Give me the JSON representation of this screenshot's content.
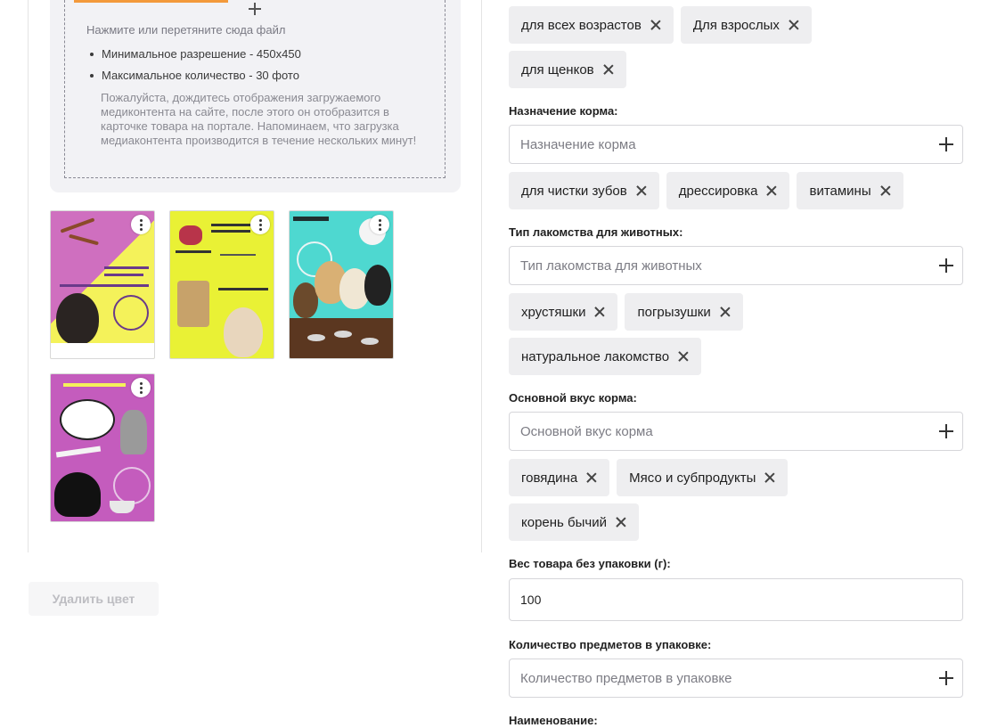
{
  "upload": {
    "hint": "Нажмите или перетяните сюда файл",
    "rules": [
      "Минимальное разрешение - 450x450",
      "Максимальное количество - 30 фото"
    ],
    "notice": "Пожалуйста, дождитесь отображения загружаемого медиконтента на сайте, после этого он отобразится в карточке товара на портале. Напоминаем, что загрузка медиаконтента производится в течение нескольких минут!"
  },
  "photos": [
    {
      "name": "photo-1",
      "colors": [
        "#cf6fbf",
        "#f4f25a"
      ]
    },
    {
      "name": "photo-2",
      "colors": [
        "#e9f135"
      ]
    },
    {
      "name": "photo-3",
      "colors": [
        "#4ed8d0"
      ]
    },
    {
      "name": "photo-4",
      "colors": [
        "#c45cbd"
      ]
    }
  ],
  "delete_color_label": "Удалить цвет",
  "age": {
    "chips": [
      "для всех возрастов",
      "Для взрослых",
      "для щенков"
    ]
  },
  "purpose": {
    "label": "Назначение корма:",
    "placeholder": "Назначение корма",
    "chips": [
      "для чистки зубов",
      "дрессировка",
      "витамины"
    ]
  },
  "treat_type": {
    "label": "Тип лакомства для животных:",
    "placeholder": "Тип лакомства для животных",
    "chips": [
      "хрустяшки",
      "погрызушки",
      "натуральное лакомство"
    ]
  },
  "flavor": {
    "label": "Основной вкус корма:",
    "placeholder": "Основной вкус корма",
    "chips": [
      "говядина",
      "Мясо и субпродукты",
      "корень бычий"
    ]
  },
  "weight": {
    "label": "Вес товара без упаковки (г):",
    "value": "100"
  },
  "quantity": {
    "label": "Количество предметов в упаковке:",
    "placeholder": "Количество предметов в упаковке"
  },
  "name_field": {
    "label": "Наименование:"
  }
}
